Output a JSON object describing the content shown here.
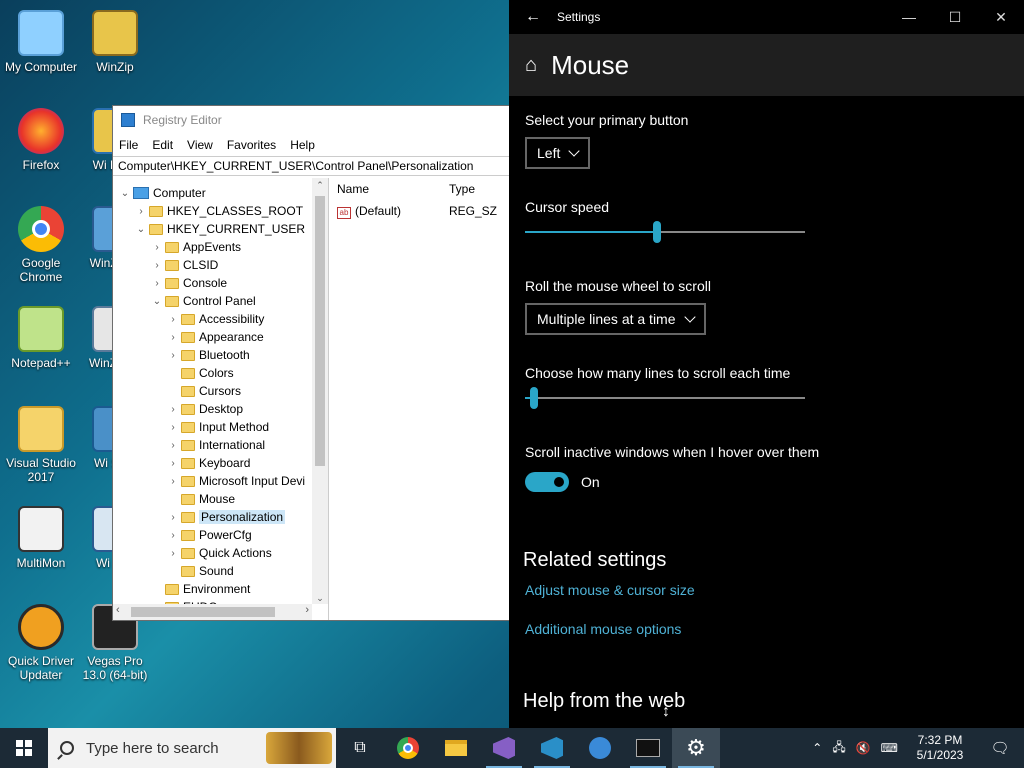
{
  "desktop": {
    "icons": [
      {
        "label": "My Computer"
      },
      {
        "label": "WinZip"
      },
      {
        "label": "Firefox"
      },
      {
        "label": "Wi Dupli"
      },
      {
        "label": "Google Chrome"
      },
      {
        "label": "WinZi Ma"
      },
      {
        "label": "Notepad++"
      },
      {
        "label": "WinZ Exp"
      },
      {
        "label": "Visual Studio 2017"
      },
      {
        "label": "Wi Safe"
      },
      {
        "label": "MultiMon"
      },
      {
        "label": "Wi Sec"
      },
      {
        "label": "Quick Driver Updater"
      },
      {
        "label": "Vegas Pro 13.0 (64-bit)"
      }
    ]
  },
  "regedit": {
    "title": "Registry Editor",
    "menu": [
      "File",
      "Edit",
      "View",
      "Favorites",
      "Help"
    ],
    "address": "Computer\\HKEY_CURRENT_USER\\Control Panel\\Personalization",
    "tree": [
      {
        "label": "Computer",
        "arrow": "⌄"
      },
      {
        "label": "HKEY_CLASSES_ROOT",
        "arrow": "›"
      },
      {
        "label": "HKEY_CURRENT_USER",
        "arrow": "⌄"
      },
      {
        "label": "AppEvents",
        "arrow": "›"
      },
      {
        "label": "CLSID",
        "arrow": "›"
      },
      {
        "label": "Console",
        "arrow": "›"
      },
      {
        "label": "Control Panel",
        "arrow": "⌄"
      },
      {
        "label": "Accessibility",
        "arrow": "›"
      },
      {
        "label": "Appearance",
        "arrow": "›"
      },
      {
        "label": "Bluetooth",
        "arrow": "›"
      },
      {
        "label": "Colors",
        "arrow": ""
      },
      {
        "label": "Cursors",
        "arrow": ""
      },
      {
        "label": "Desktop",
        "arrow": "›"
      },
      {
        "label": "Input Method",
        "arrow": "›"
      },
      {
        "label": "International",
        "arrow": "›"
      },
      {
        "label": "Keyboard",
        "arrow": "›"
      },
      {
        "label": "Microsoft Input Devi",
        "arrow": "›"
      },
      {
        "label": "Mouse",
        "arrow": ""
      },
      {
        "label": "Personalization",
        "arrow": "›"
      },
      {
        "label": "PowerCfg",
        "arrow": "›"
      },
      {
        "label": "Quick Actions",
        "arrow": "›"
      },
      {
        "label": "Sound",
        "arrow": ""
      },
      {
        "label": "Environment",
        "arrow": ""
      },
      {
        "label": "EUDC",
        "arrow": "›"
      }
    ],
    "list_headers": {
      "name": "Name",
      "type": "Type"
    },
    "list_rows": [
      {
        "name": "(Default)",
        "type": "REG_SZ",
        "icon": "ab"
      }
    ]
  },
  "settings": {
    "window_title": "Settings",
    "page_title": "Mouse",
    "primary_button_label": "Select your primary button",
    "primary_button_value": "Left",
    "cursor_speed_label": "Cursor speed",
    "cursor_speed_level": 0.47,
    "scroll_label": "Roll the mouse wheel to scroll",
    "scroll_value": "Multiple lines at a time",
    "lines_label": "Choose how many lines to scroll each time",
    "lines_level": 0.02,
    "inactive_label": "Scroll inactive windows when I hover over them",
    "inactive_state": "On",
    "related_heading": "Related settings",
    "link_adjust": "Adjust mouse & cursor size",
    "link_additional": "Additional mouse options",
    "help_heading": "Help from the web",
    "accent_color": "#2aa6c8",
    "link_color": "#4fb2d6"
  },
  "taskbar": {
    "search_placeholder": "Type here to search",
    "time": "7:32 PM",
    "date": "5/1/2023",
    "apps": [
      "task-view-icon",
      "chrome-icon",
      "file-explorer-icon",
      "visual-studio-icon",
      "visual-studio-2-icon",
      "network-app-icon",
      "terminal-icon",
      "settings-gear-icon"
    ]
  }
}
